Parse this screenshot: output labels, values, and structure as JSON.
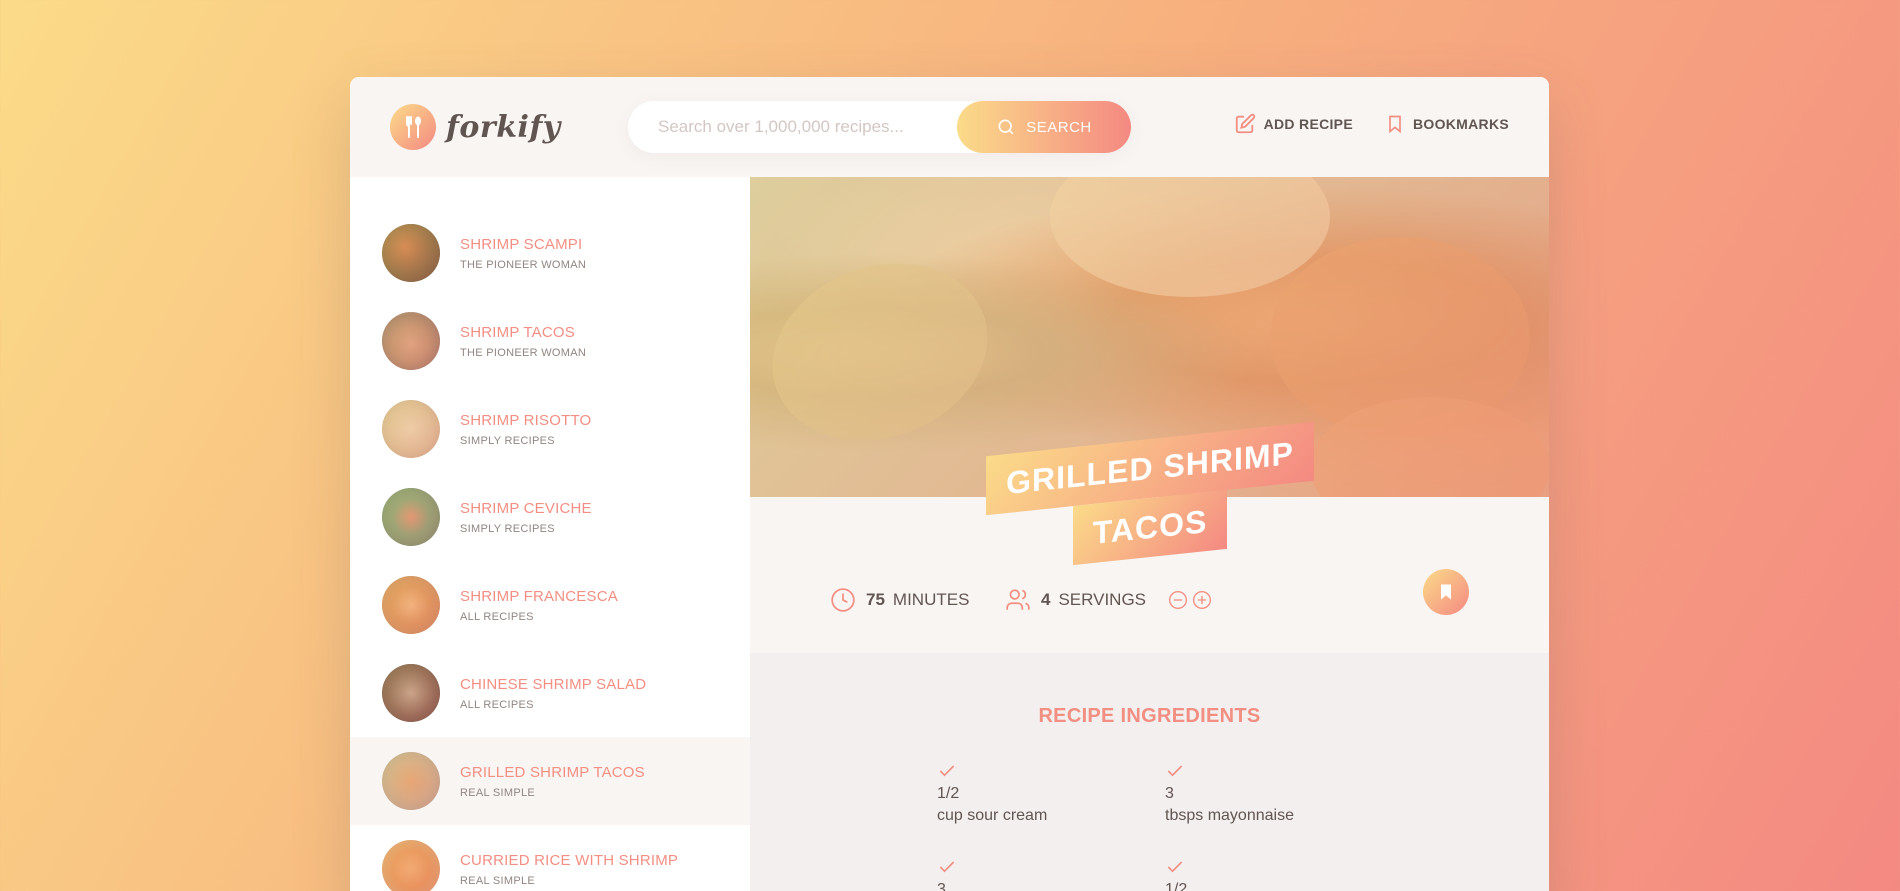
{
  "header": {
    "logo_text": "forkify",
    "search_placeholder": "Search over 1,000,000 recipes...",
    "search_button_label": "SEARCH",
    "add_recipe_label": "ADD RECIPE",
    "bookmarks_label": "BOOKMARKS"
  },
  "results": [
    {
      "title": "SHRIMP SCAMPI",
      "publisher": "THE PIONEER WOMAN"
    },
    {
      "title": "SHRIMP TACOS",
      "publisher": "THE PIONEER WOMAN"
    },
    {
      "title": "SHRIMP RISOTTO",
      "publisher": "SIMPLY RECIPES"
    },
    {
      "title": "SHRIMP CEVICHE",
      "publisher": "SIMPLY RECIPES"
    },
    {
      "title": "SHRIMP FRANCESCA",
      "publisher": "ALL RECIPES"
    },
    {
      "title": "CHINESE SHRIMP SALAD",
      "publisher": "ALL RECIPES"
    },
    {
      "title": "GRILLED SHRIMP TACOS",
      "publisher": "REAL SIMPLE"
    },
    {
      "title": "CURRIED RICE WITH SHRIMP",
      "publisher": "REAL SIMPLE"
    }
  ],
  "recipe": {
    "title_line1": "GRILLED SHRIMP",
    "title_line2": "TACOS",
    "minutes": "75",
    "minutes_label": "MINUTES",
    "servings": "4",
    "servings_label": "SERVINGS",
    "ingredients_heading": "RECIPE INGREDIENTS",
    "ingredients": [
      {
        "qty": "1/2",
        "desc": "cup sour cream"
      },
      {
        "qty": "3",
        "desc": "tbsps mayonnaise"
      },
      {
        "qty": "3",
        "desc": ""
      },
      {
        "qty": "1/2",
        "desc": ""
      }
    ]
  },
  "colors": {
    "accent": "#f38e82",
    "gradient_start": "#fbdb89",
    "gradient_end": "#f48982",
    "text": "#615551"
  }
}
